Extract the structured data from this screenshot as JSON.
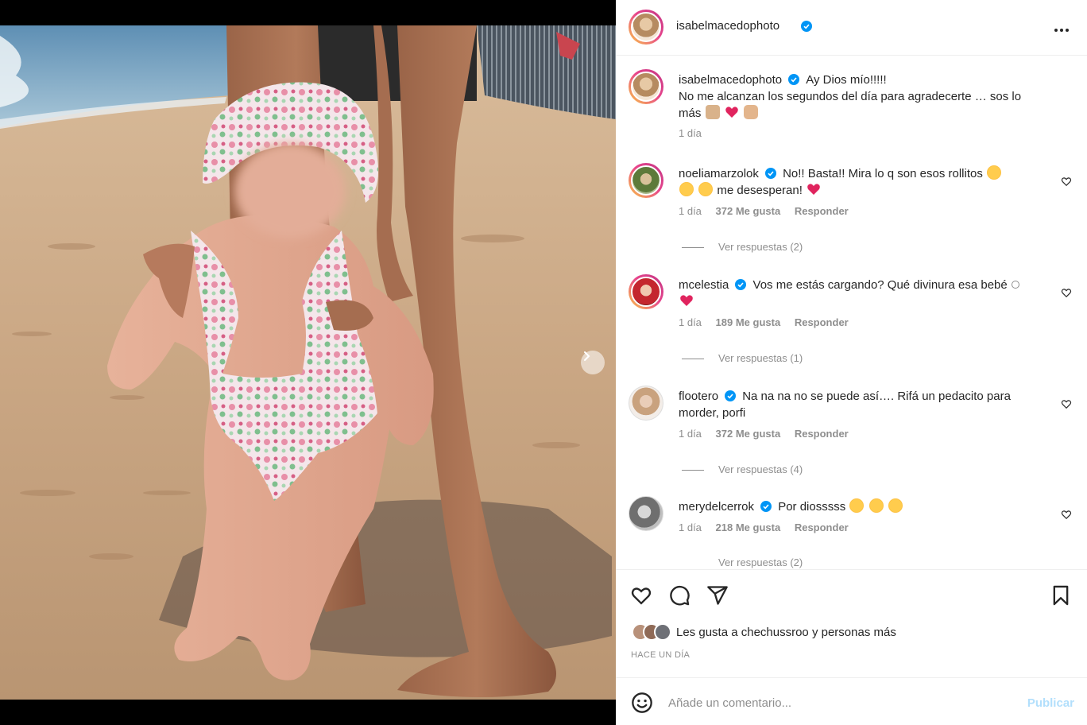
{
  "post": {
    "username": "isabelmacedophoto",
    "verified": true,
    "more_icon": "more-horizontal-icon"
  },
  "caption": {
    "username": "isabelmacedophoto",
    "text": "Ay Dios mío!!!!!",
    "line2": "No me alcanzan los segundos del día para agradecerte … sos lo",
    "line3": "más",
    "time": "1 día"
  },
  "comments": [
    {
      "username": "noeliamarzolok",
      "text": "No!! Basta!! Mira lo q son esos rollitos",
      "text2": "me desesperan!",
      "time": "1 día",
      "likes": "372 Me gusta",
      "reply": "Responder",
      "view_replies": "Ver respuestas (2)"
    },
    {
      "username": "mcelestia",
      "text": "Vos me estás cargando? Qué divinura esa bebé",
      "time": "1 día",
      "likes": "189 Me gusta",
      "reply": "Responder",
      "view_replies": "Ver respuestas (1)"
    },
    {
      "username": "flootero",
      "text": "Na na na no se puede así…. Rifá un pedacito para",
      "text2": "morder, porfi",
      "time": "1 día",
      "likes": "372 Me gusta",
      "reply": "Responder",
      "view_replies": "Ver respuestas (4)"
    },
    {
      "username": "merydelcerrok",
      "text": "Por diosssss",
      "time": "1 día",
      "likes": "218 Me gusta",
      "reply": "Responder",
      "view_replies": "Ver respuestas (2)"
    }
  ],
  "likes_line": "Les gusta a chechussroo y personas más",
  "time_ago": "HACE UN DÍA",
  "comment_box": {
    "placeholder": "Añade un comentario...",
    "post_label": "Publicar"
  },
  "colors": {
    "verified_blue": "#0095f6",
    "heart_red": "#ed4956",
    "post_button_disabled": "#b2dffc",
    "muted_text": "#8e8e8e"
  },
  "icons": [
    "heart-icon",
    "comment-icon",
    "share-icon",
    "bookmark-icon",
    "emoji-icon",
    "next-arrow-icon"
  ]
}
